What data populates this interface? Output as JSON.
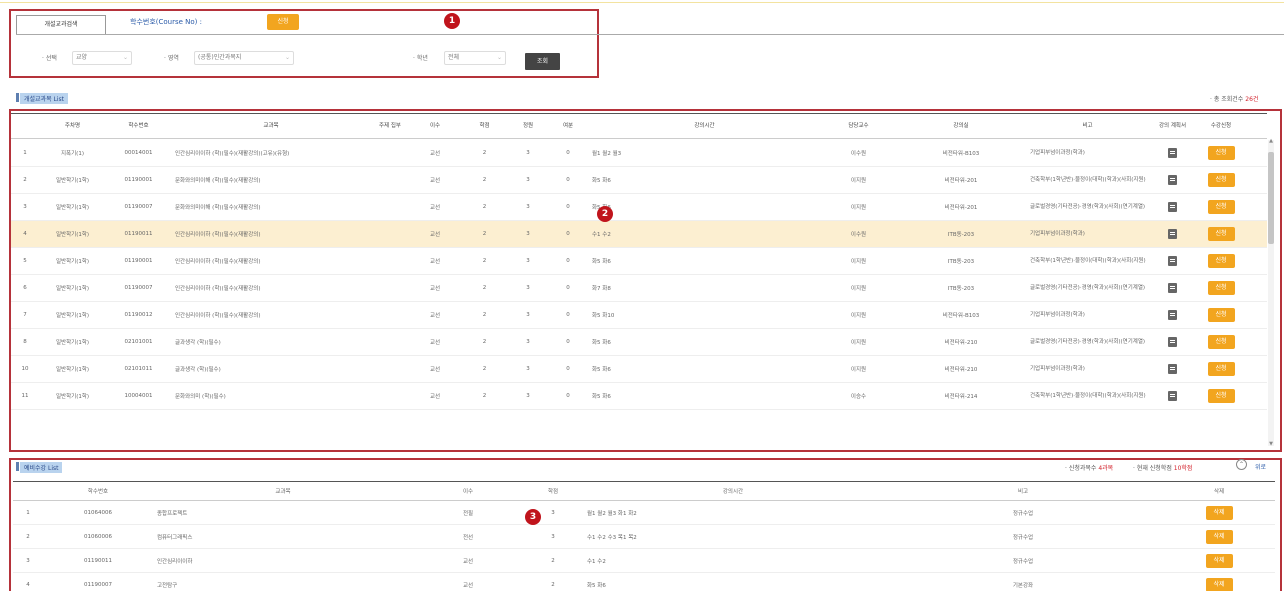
{
  "search": {
    "tab_label": "개설교과검색",
    "course_no_label": "학수번호(Course No) :",
    "apply_label": "신청",
    "filters": [
      {
        "label": "· 선택",
        "value": "교양"
      },
      {
        "label": "· 영역",
        "value": "(공통)인간과복지"
      },
      {
        "label": "· 학년",
        "value": "전체"
      }
    ],
    "search_button": "조회"
  },
  "markers": [
    "1",
    "2",
    "3"
  ],
  "course_list": {
    "title": "개설교과목 List",
    "total_label": "· 총 조회건수",
    "total_count": "26건",
    "headers": [
      "주차명",
      "학수번호",
      "교과목",
      "주제\n집부",
      "이수",
      "학점",
      "정원",
      "여분",
      "강의시간",
      "담당교수",
      "강의실",
      "비고",
      "강의\n계획서",
      "수강신청"
    ],
    "rows": [
      {
        "no": "1",
        "cat": "지폭기(1)",
        "code": "00014001",
        "name": "인간심리이이하 (학)(필수)(재활강의)(고유)(유형)",
        "type": "교선",
        "credit": "2",
        "cap": "3",
        "rem": "0",
        "time": "월1 월2 월3",
        "prof": "이수원",
        "room": "비전타워-B103",
        "note": "기업피부넘이과정(학과)",
        "apply": "신청"
      },
      {
        "no": "2",
        "cat": "일반학기(1학)",
        "code": "01190001",
        "name": "문화와의미이해 (학)(필수)(재활강의)",
        "type": "교선",
        "credit": "2",
        "cap": "3",
        "rem": "0",
        "time": "화5 화6",
        "prof": "이지원",
        "room": "비전타워-201",
        "note": "건축학부(1학년반)·물정이(대학)(학과)(사회(지원)",
        "apply": "신청"
      },
      {
        "no": "3",
        "cat": "일반학기(1학)",
        "code": "01190007",
        "name": "문화와의미이해 (학)(필수)(재활강의)",
        "type": "교선",
        "credit": "2",
        "cap": "3",
        "rem": "0",
        "time": "화5 화6",
        "prof": "이지원",
        "room": "비전타워-201",
        "note": "글로벌경영(기타전공)·경영(학과)(사회)(연기계열)",
        "apply": "신청"
      },
      {
        "no": "4",
        "cat": "일반학기(1학)",
        "code": "01190011",
        "name": "인간심리이이하 (학)(필수)(재활강의)",
        "type": "교선",
        "credit": "2",
        "cap": "3",
        "rem": "0",
        "time": "수1 수2",
        "prof": "이수원",
        "room": "ITB동-203",
        "note": "기업피부넘이과정(학과)",
        "apply": "신청"
      },
      {
        "no": "5",
        "cat": "일반학기(1학)",
        "code": "01190001",
        "name": "인간심리이이하 (학)(필수)(재활강의)",
        "type": "교선",
        "credit": "2",
        "cap": "3",
        "rem": "0",
        "time": "화5 화6",
        "prof": "이지원",
        "room": "ITB동-203",
        "note": "건축학부(1학년반)·물정이(대학)(학과)(사회(지원)",
        "apply": "신청"
      },
      {
        "no": "6",
        "cat": "일반학기(1학)",
        "code": "01190007",
        "name": "인간심리이이하 (학)(필수)(재활강의)",
        "type": "교선",
        "credit": "2",
        "cap": "3",
        "rem": "0",
        "time": "화7 화8",
        "prof": "이지원",
        "room": "ITB동-203",
        "note": "글로벌경영(기타전공)·경영(학과)(사회)(연기계열)",
        "apply": "신청"
      },
      {
        "no": "7",
        "cat": "일반학기(1학)",
        "code": "01190012",
        "name": "인간심리이이하 (학)(필수)(재활강의)",
        "type": "교선",
        "credit": "2",
        "cap": "3",
        "rem": "0",
        "time": "화5 화10",
        "prof": "이지원",
        "room": "비전타워-B103",
        "note": "기업피부넘이과정(학과)",
        "apply": "신청"
      },
      {
        "no": "8",
        "cat": "일반학기(1학)",
        "code": "02101001",
        "name": "글과생각 (학)(필수)",
        "type": "교선",
        "credit": "2",
        "cap": "3",
        "rem": "0",
        "time": "화5 화6",
        "prof": "이지원",
        "room": "비전타워-210",
        "note": "글로벌경영(기타전공)·경영(학과)(사회)(연기계열)",
        "apply": "신청"
      },
      {
        "no": "10",
        "cat": "일반학기(1학)",
        "code": "02101011",
        "name": "글과생각 (학)(필수)",
        "type": "교선",
        "credit": "2",
        "cap": "3",
        "rem": "0",
        "time": "화5 화6",
        "prof": "이지원",
        "room": "비전타워-210",
        "note": "기업피부넘이과정(학과)",
        "apply": "신청"
      },
      {
        "no": "11",
        "cat": "일반학기(1학)",
        "code": "10004001",
        "name": "문화와의미 (학)(필수)",
        "type": "교선",
        "credit": "2",
        "cap": "3",
        "rem": "0",
        "time": "화5 화6",
        "prof": "이승수",
        "room": "비전타워-214",
        "note": "건축학부(1학년반)·물정이(대학)(학과)(사회(지원)",
        "apply": "신청"
      }
    ]
  },
  "cart": {
    "title": "예비수강 List",
    "credits_label": "· 신청과목수",
    "credits_value": "4과목",
    "max_label": "· 현재 신청학점",
    "max_value": "10학점",
    "up_label": "위로",
    "headers": [
      "학수번호",
      "교과목",
      "이수",
      "학점",
      "강의시간",
      "비고",
      "삭제"
    ],
    "rows": [
      {
        "no": "1",
        "code": "01064006",
        "name": "종합프로젝트",
        "type": "전필",
        "credit": "3",
        "time": "월1 월2 월3 화1 화2",
        "note": "정규수업",
        "del": "삭제"
      },
      {
        "no": "2",
        "code": "01060006",
        "name": "컴퓨터그래픽스",
        "type": "전선",
        "credit": "3",
        "time": "수1 수2 수3 목1 목2",
        "note": "정규수업",
        "del": "삭제"
      },
      {
        "no": "3",
        "code": "01190011",
        "name": "인간심리이이하",
        "type": "교선",
        "credit": "2",
        "time": "수1 수2",
        "note": "정규수업",
        "del": "삭제"
      },
      {
        "no": "4",
        "code": "01190007",
        "name": "고전탐구",
        "type": "교선",
        "credit": "2",
        "time": "화5 화6",
        "note": "기본강좌",
        "del": "삭제"
      }
    ]
  }
}
